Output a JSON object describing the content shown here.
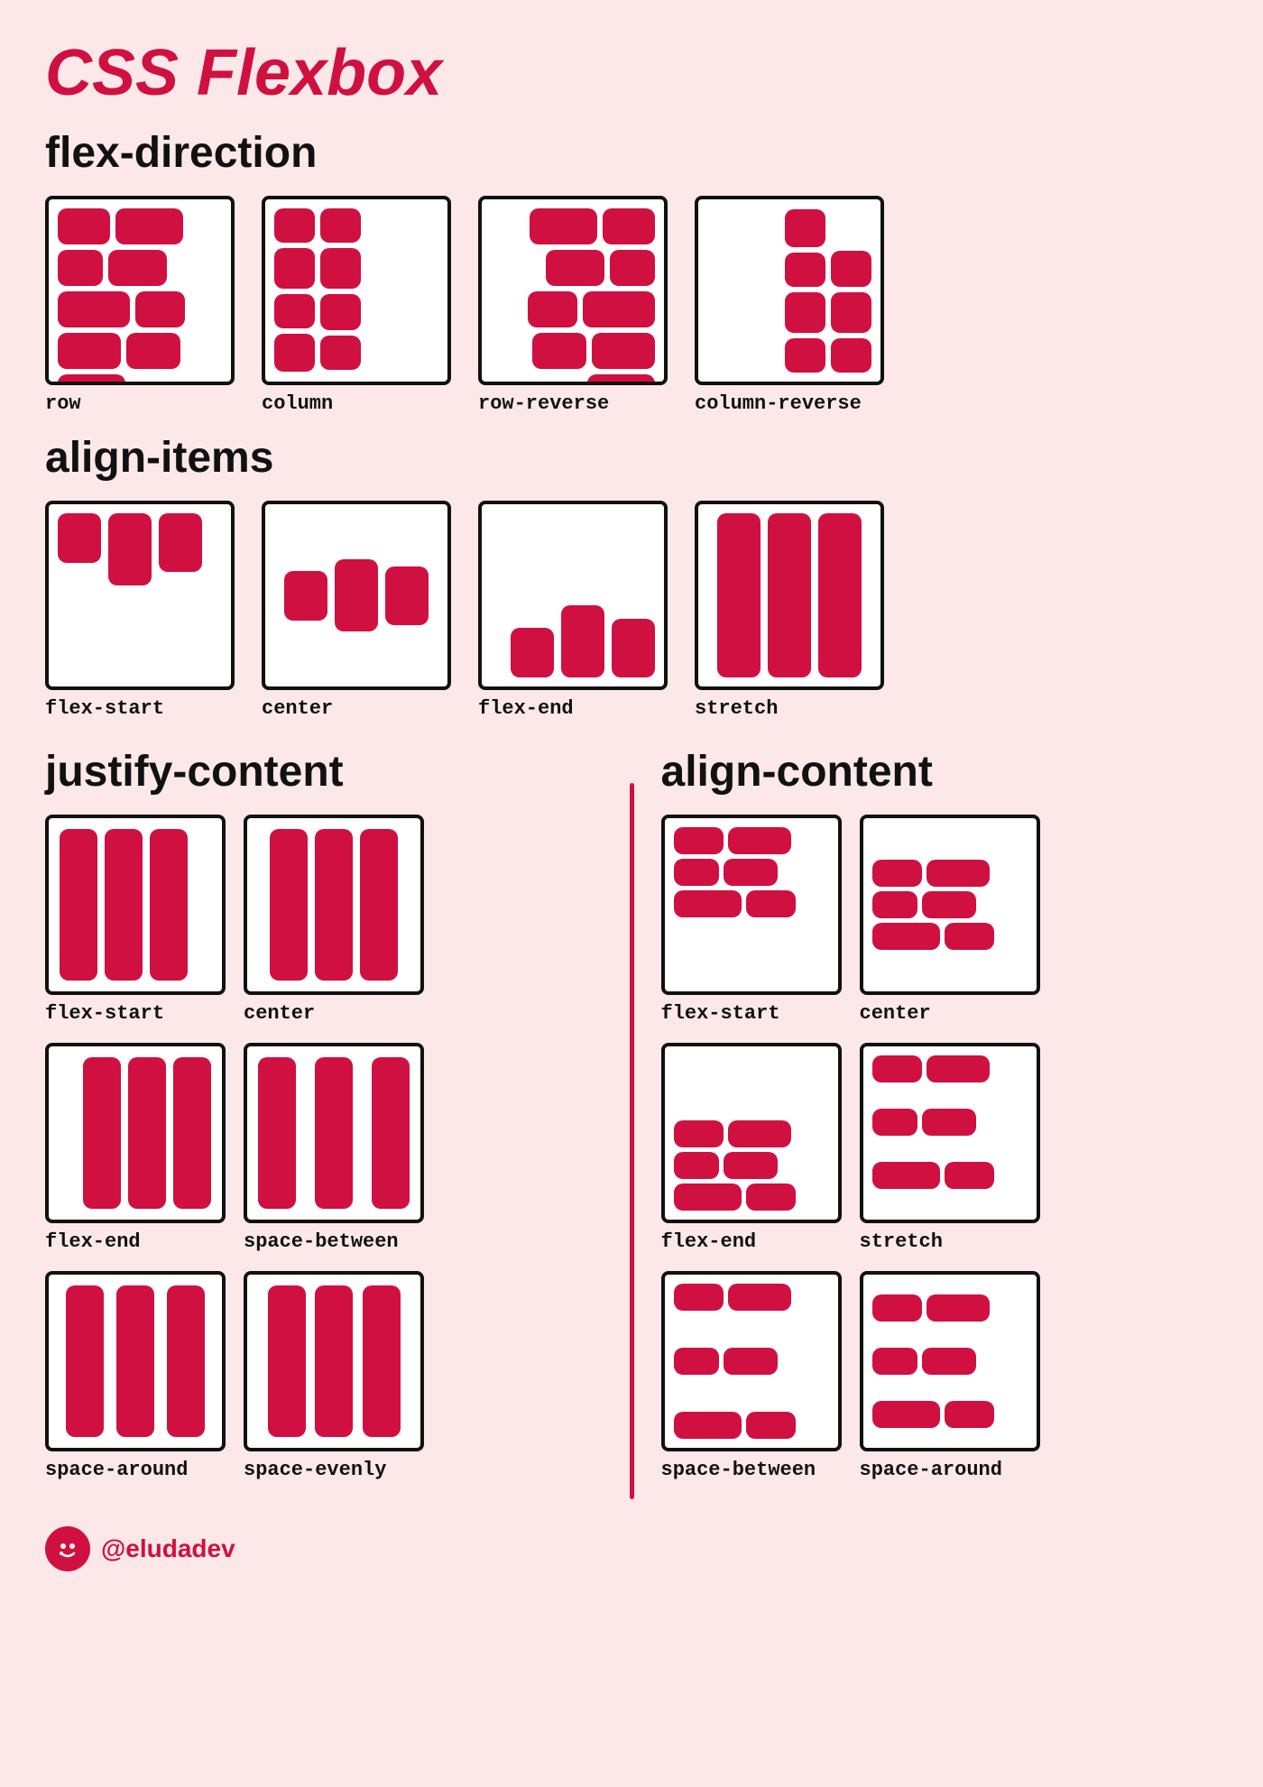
{
  "title": "CSS Flexbox",
  "sections": {
    "flex_direction": {
      "title": "flex-direction",
      "items": [
        {
          "label": "row"
        },
        {
          "label": "column"
        },
        {
          "label": "row-reverse"
        },
        {
          "label": "column-reverse"
        }
      ]
    },
    "align_items": {
      "title": "align-items",
      "items": [
        {
          "label": "flex-start"
        },
        {
          "label": "center"
        },
        {
          "label": "flex-end"
        },
        {
          "label": "stretch"
        }
      ]
    },
    "justify_content": {
      "title": "justify-content",
      "items": [
        {
          "label": "flex-start"
        },
        {
          "label": "center"
        },
        {
          "label": "flex-end"
        },
        {
          "label": "space-between"
        },
        {
          "label": "space-around"
        },
        {
          "label": "space-evenly"
        }
      ]
    },
    "align_content": {
      "title": "align-content",
      "items": [
        {
          "label": "flex-start"
        },
        {
          "label": "center"
        },
        {
          "label": "flex-end"
        },
        {
          "label": "stretch"
        },
        {
          "label": "space-between"
        },
        {
          "label": "space-around"
        }
      ]
    }
  },
  "footer": {
    "handle": "@eludadev"
  },
  "colors": {
    "primary": "#d01040",
    "background": "#fce8e8",
    "text": "#111111",
    "white": "#ffffff"
  }
}
